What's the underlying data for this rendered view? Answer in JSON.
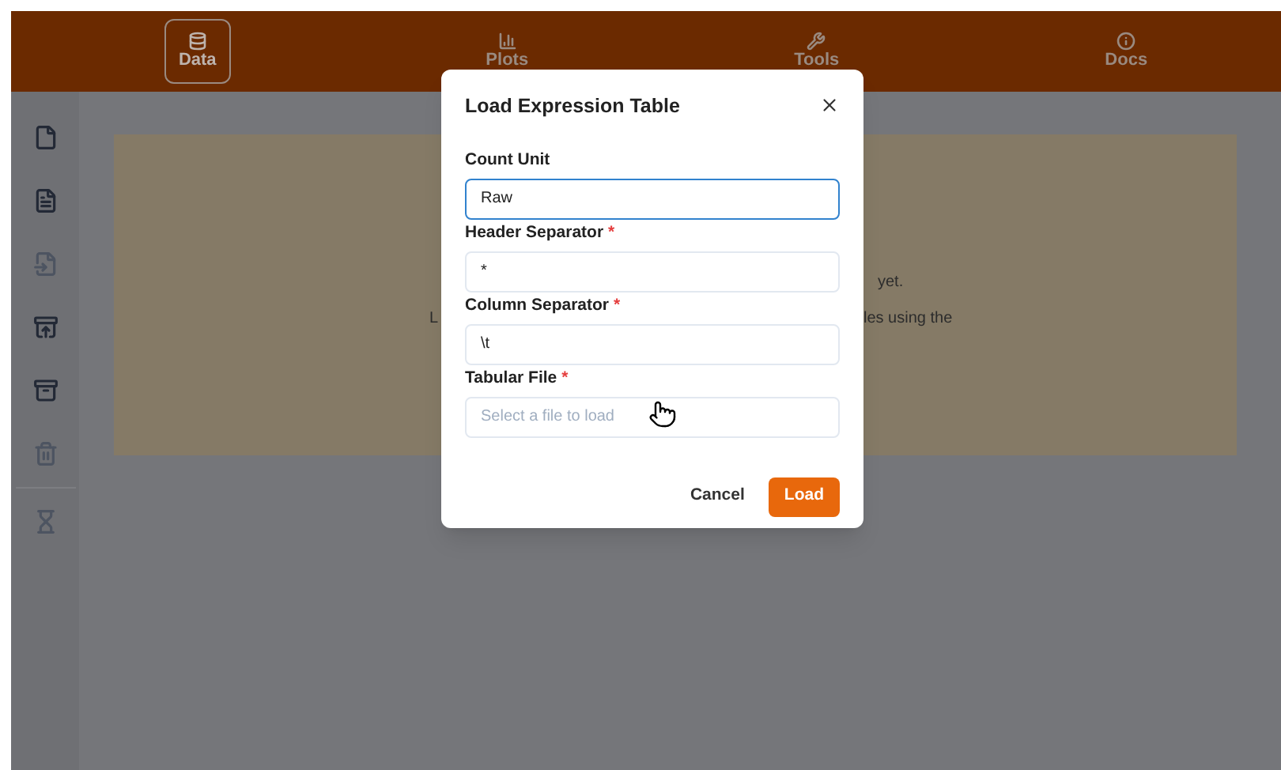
{
  "nav": {
    "items": [
      {
        "label": "Data",
        "selected": true
      },
      {
        "label": "Plots",
        "selected": false
      },
      {
        "label": "Tools",
        "selected": false
      },
      {
        "label": "Docs",
        "selected": false
      }
    ]
  },
  "sidebar": {
    "items": [
      {
        "disabled": false
      },
      {
        "disabled": false
      },
      {
        "disabled": true
      },
      {
        "disabled": false
      },
      {
        "disabled": false
      },
      {
        "disabled": true
      },
      {
        "disabled": true
      }
    ]
  },
  "panel": {
    "lines": [
      {
        "right": "yet."
      },
      {
        "left": "L",
        "right": "les using the"
      }
    ]
  },
  "dialog": {
    "title": "Load Expression Table",
    "fields": [
      {
        "label": "Count Unit",
        "required": false,
        "focused": true,
        "value": "Raw"
      },
      {
        "label": "Header Separator",
        "required": true,
        "focused": false,
        "value": "*"
      },
      {
        "label": "Column Separator",
        "required": true,
        "focused": false,
        "value": "\\t"
      },
      {
        "label": "Tabular File",
        "required": true,
        "focused": false,
        "placeholder": "Select a file to load"
      }
    ],
    "buttons": [
      {
        "label": "Cancel",
        "kind": "secondary"
      },
      {
        "label": "Load",
        "kind": "primary"
      }
    ]
  }
}
